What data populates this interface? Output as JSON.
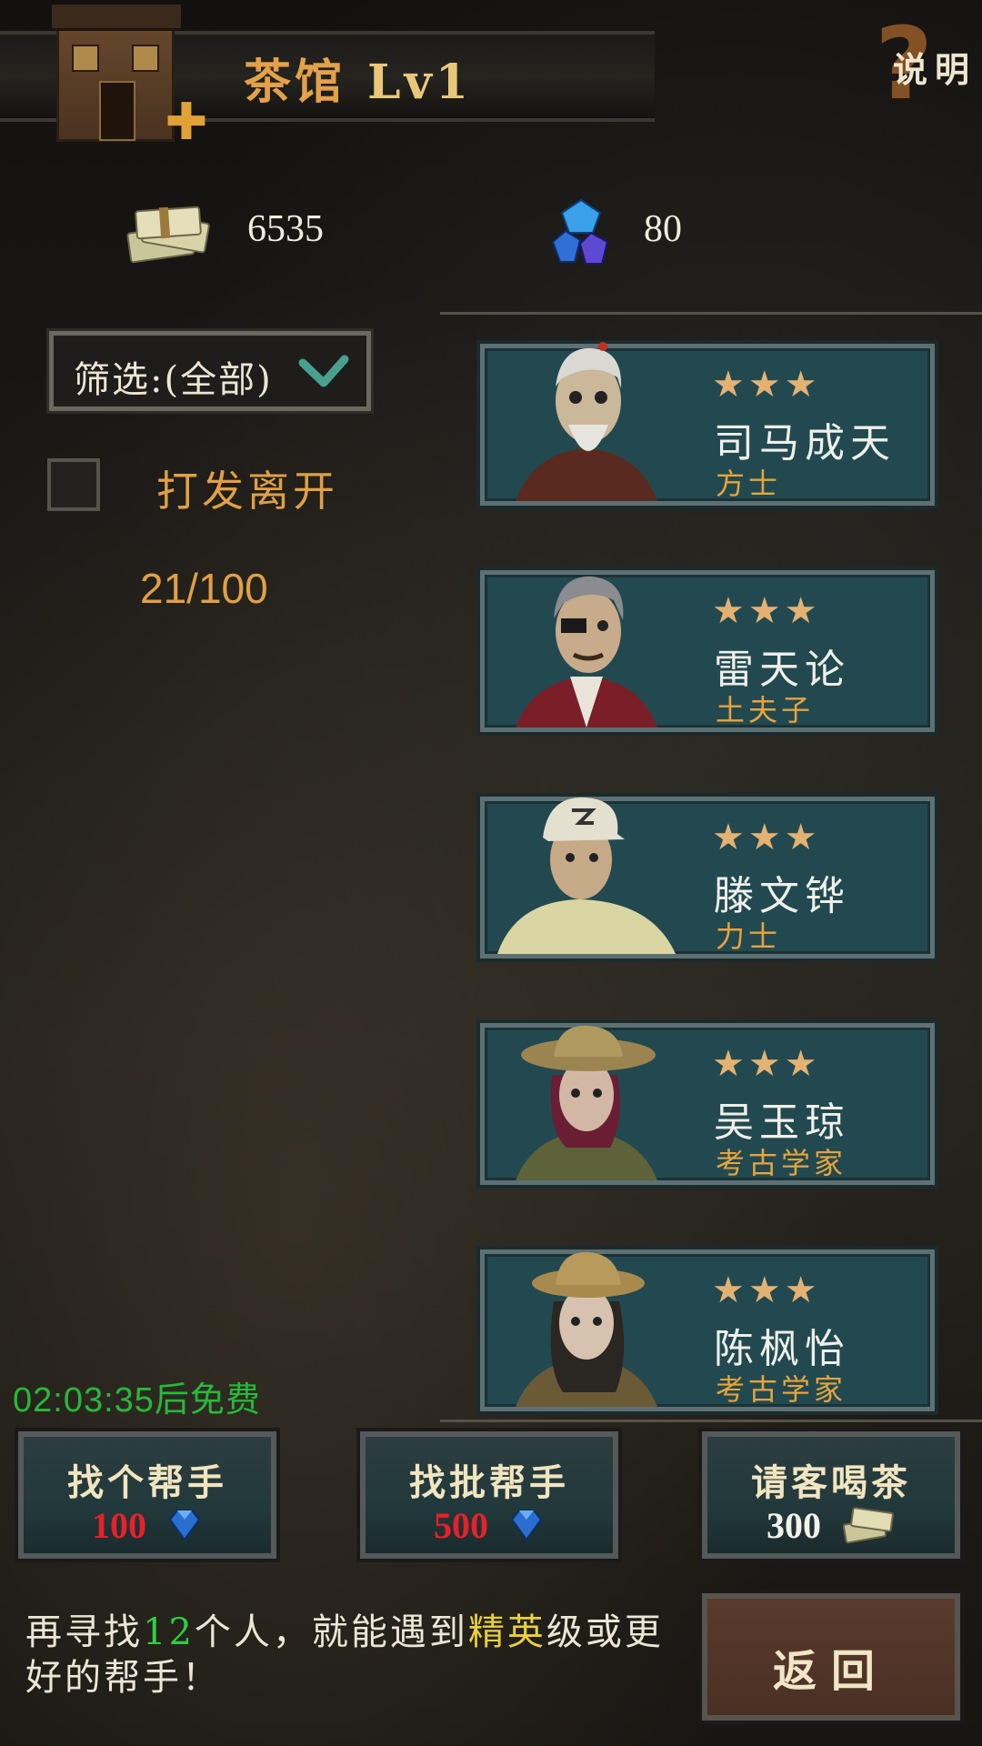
{
  "header": {
    "title": "茶馆",
    "level": "Lv1",
    "help_label": "说明"
  },
  "currency": {
    "cash": "6535",
    "gems": "80"
  },
  "filter": {
    "label": "筛选:(全部)"
  },
  "dismiss": {
    "label": "打发离开",
    "checked": false
  },
  "capacity": "21/100",
  "heroes": [
    {
      "stars": "★★★",
      "name": "司马成天",
      "class": "方士"
    },
    {
      "stars": "★★★",
      "name": "雷天论",
      "class": "土夫子"
    },
    {
      "stars": "★★★",
      "name": "滕文铧",
      "class": "力士"
    },
    {
      "stars": "★★★",
      "name": "吴玉琼",
      "class": "考古学家"
    },
    {
      "stars": "★★★",
      "name": "陈枫怡",
      "class": "考古学家"
    }
  ],
  "free_timer": "02:03:35后免费",
  "actions": [
    {
      "title": "找个帮手",
      "cost": "100",
      "currency": "gem-icon"
    },
    {
      "title": "找批帮手",
      "cost": "500",
      "currency": "gem-icon"
    },
    {
      "title": "请客喝茶",
      "cost": "300",
      "currency": "cash-icon"
    }
  ],
  "hint": {
    "prefix": "再寻找",
    "count": "12",
    "middle": "个人，就能遇到",
    "tier": "精英",
    "suffix": "级或更好的帮手！"
  },
  "back_label": "返回",
  "colors": {
    "card_bg": "#234950",
    "accent_orange": "#e0a046",
    "timer_green": "#27b83b",
    "cost_red": "#e8202a"
  }
}
